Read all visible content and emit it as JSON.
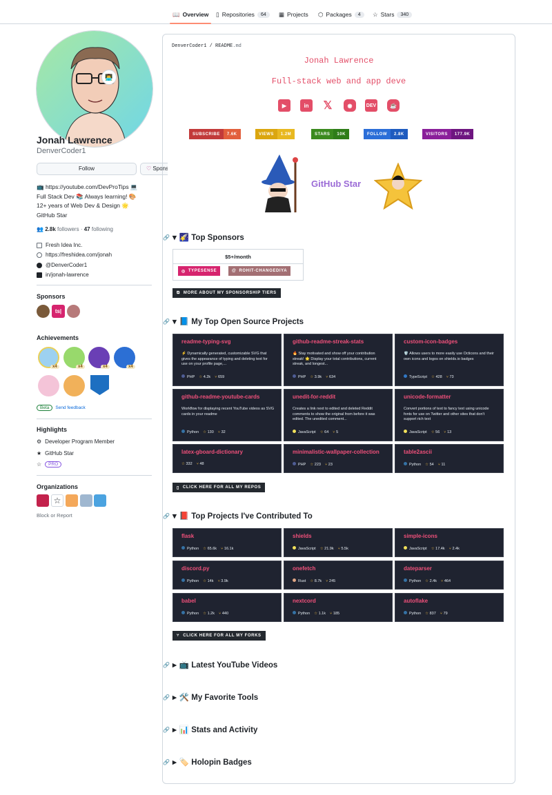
{
  "tabs": [
    {
      "label": "Overview",
      "count": ""
    },
    {
      "label": "Repositories",
      "count": "64"
    },
    {
      "label": "Projects",
      "count": ""
    },
    {
      "label": "Packages",
      "count": "4"
    },
    {
      "label": "Stars",
      "count": "340"
    }
  ],
  "profile": {
    "name": "Jonah Lawrence",
    "login": "DenverCoder1",
    "follow": "Follow",
    "sponsor": "Sponsor",
    "status_emoji": "👨‍💻",
    "bio": [
      "📺 https://youtube.com/DevProTips 💻",
      "Full Stack Dev 📚 Always learning! 🎨",
      "12+ years of Web Dev & Design 🌟",
      "GitHub Star"
    ],
    "followers": "2.8k",
    "followers_label": "followers",
    "following": "47",
    "following_label": "following",
    "company": "Fresh Idea Inc.",
    "website": "https://freshidea.com/jonah",
    "twitter": "@DenverCoder1",
    "linkedin": "in/jonah-lawrence"
  },
  "sponsors_heading": "Sponsors",
  "sponsor_ts": "ts|",
  "achievements_heading": "Achievements",
  "ach_counts": [
    "x4",
    "x4",
    "x4",
    "x4"
  ],
  "beta": "Beta",
  "feedback": "Send feedback",
  "highlights_heading": "Highlights",
  "highlights": [
    "Developer Program Member",
    "GitHub Star",
    "PRO"
  ],
  "orgs_heading": "Organizations",
  "block": "Block or Report",
  "readme": {
    "crumb_user": "DenverCoder1",
    "crumb_sep": " / ",
    "crumb_file": "README",
    "crumb_ext": ".md",
    "line1": "Jonah Lawrence",
    "line2": "Full-stack web and app deve",
    "badges": [
      {
        "l": "SUBSCRIBE",
        "v": "7.6K",
        "c1": "#c23a3a",
        "c2": "#e25f3c"
      },
      {
        "l": "VIEWS",
        "v": "1.2M",
        "c1": "#dba60f",
        "c2": "#e8b820"
      },
      {
        "l": "STARS",
        "v": "10K",
        "c1": "#3a8a1e",
        "c2": "#2e7d18"
      },
      {
        "l": "FOLLOW",
        "v": "2.8K",
        "c1": "#2b6ed8",
        "c2": "#1e5bbf"
      },
      {
        "l": "VISITORS",
        "v": "177.9K",
        "c1": "#8a1f9a",
        "c2": "#6e1580"
      }
    ],
    "gh_star": "GitHub Star",
    "s_sponsors": "🌠 Top Sponsors",
    "tier": "$5+/month",
    "sp1": "TYPESENSE",
    "sp2": "ROHIT-CHANGEDIYA",
    "btn_sponsors": "MORE ABOUT MY SPONSORSHIP TIERS",
    "s_oss": "📘 My Top Open Source Projects",
    "btn_repos": "CLICK HERE FOR ALL MY REPOS",
    "s_contrib": "📕 Top Projects I've Contributed To",
    "btn_forks": "CLICK HERE FOR ALL MY FORKS",
    "s_yt": "📺 Latest YouTube Videos",
    "s_tools": "🛠️ My Favorite Tools",
    "s_stats": "📊 Stats and Activity",
    "s_holo": "🏷️ Holopin Badges"
  },
  "oss": [
    {
      "name": "readme-typing-svg",
      "desc": "⚡ Dynamically generated, customizable SVG that gives the appearance of typing and deleting text for use on your profile page,...",
      "lang": "PHP",
      "color": "#4F5D95",
      "stars": "4.2k",
      "forks": "659"
    },
    {
      "name": "github-readme-streak-stats",
      "desc": "🔥 Stay motivated and show off your contribution streak! 🌟 Display your total contributions, current streak, and longest...",
      "lang": "PHP",
      "color": "#4F5D95",
      "stars": "3.9k",
      "forks": "634"
    },
    {
      "name": "custom-icon-badges",
      "desc": "🛡️ Allows users to more easily use Octicons and their own icons and logos on shields.io badges",
      "lang": "TypeScript",
      "color": "#3178c6",
      "stars": "428",
      "forks": "73"
    },
    {
      "name": "github-readme-youtube-cards",
      "desc": "Workflow for displaying recent YouTube videos as SVG cards in your readme",
      "lang": "Python",
      "color": "#3572A5",
      "stars": "130",
      "forks": "32"
    },
    {
      "name": "unedit-for-reddit",
      "desc": "Creates a link next to edited and deleted Reddit comments to show the original from before it was edited. The unedited comment...",
      "lang": "JavaScript",
      "color": "#f1e05a",
      "stars": "64",
      "forks": "5"
    },
    {
      "name": "unicode-formatter",
      "desc": "Convert portions of text to fancy text using unicode fonts for use on Twitter and other sites that don't support rich text",
      "lang": "JavaScript",
      "color": "#f1e05a",
      "stars": "56",
      "forks": "13"
    },
    {
      "name": "latex-gboard-dictionary",
      "desc": "",
      "lang": "",
      "color": "",
      "stars": "332",
      "forks": "48"
    },
    {
      "name": "minimalistic-wallpaper-collection",
      "desc": "",
      "lang": "PHP",
      "color": "#4F5D95",
      "stars": "223",
      "forks": "23"
    },
    {
      "name": "table2ascii",
      "desc": "",
      "lang": "Python",
      "color": "#3572A5",
      "stars": "54",
      "forks": "11"
    }
  ],
  "contrib": [
    {
      "name": "flask",
      "lang": "Python",
      "color": "#3572A5",
      "stars": "65.6k",
      "forks": "16.1k"
    },
    {
      "name": "shields",
      "lang": "JavaScript",
      "color": "#f1e05a",
      "stars": "21.9k",
      "forks": "5.5k"
    },
    {
      "name": "simple-icons",
      "lang": "JavaScript",
      "color": "#f1e05a",
      "stars": "17.4k",
      "forks": "2.4k"
    },
    {
      "name": "discord.py",
      "lang": "Python",
      "color": "#3572A5",
      "stars": "14k",
      "forks": "3.9k"
    },
    {
      "name": "onefetch",
      "lang": "Rust",
      "color": "#dea584",
      "stars": "8.7k",
      "forks": "245"
    },
    {
      "name": "dateparser",
      "lang": "Python",
      "color": "#3572A5",
      "stars": "2.4k",
      "forks": "464"
    },
    {
      "name": "babel",
      "lang": "Python",
      "color": "#3572A5",
      "stars": "1.2k",
      "forks": "440"
    },
    {
      "name": "nextcord",
      "lang": "Python",
      "color": "#3572A5",
      "stars": "1.1k",
      "forks": "185"
    },
    {
      "name": "autoflake",
      "lang": "Python",
      "color": "#3572A5",
      "stars": "837",
      "forks": "79"
    }
  ]
}
